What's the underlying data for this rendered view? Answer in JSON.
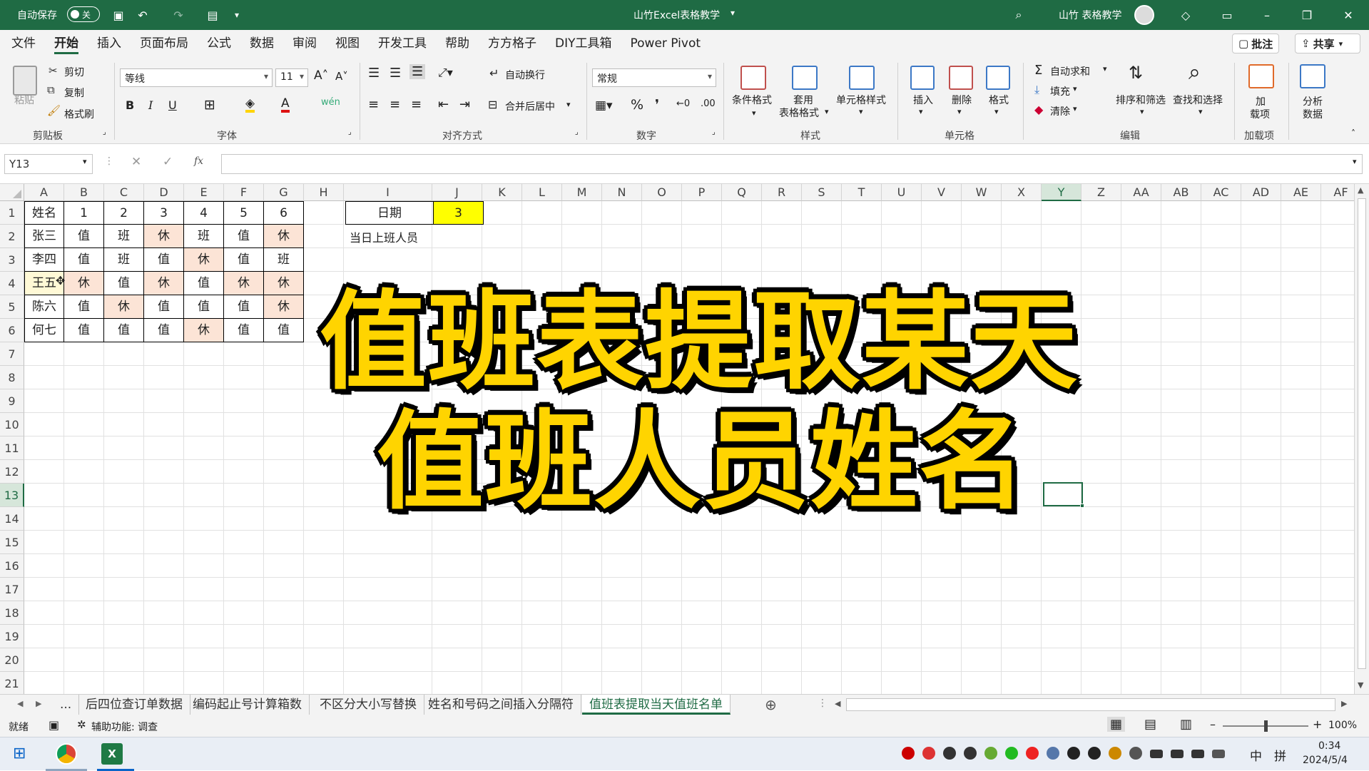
{
  "titlebar": {
    "autosave_label": "自动保存",
    "autosave_state": "关",
    "doc_title": "山竹Excel表格教学",
    "user_name": "山竹 表格教学"
  },
  "menu": {
    "tabs": [
      "文件",
      "开始",
      "插入",
      "页面布局",
      "公式",
      "数据",
      "审阅",
      "视图",
      "开发工具",
      "帮助",
      "方方格子",
      "DIY工具箱",
      "Power Pivot"
    ],
    "comments_label": "批注",
    "share_label": "共享"
  },
  "ribbon": {
    "clipboard": {
      "paste": "粘贴",
      "cut": "剪切",
      "copy": "复制",
      "format_painter": "格式刷",
      "group": "剪贴板"
    },
    "font": {
      "name": "等线",
      "size": "11",
      "group": "字体",
      "bold": "B",
      "italic": "I",
      "underline": "U"
    },
    "align": {
      "wrap": "自动换行",
      "merge": "合并后居中",
      "group": "对齐方式"
    },
    "number": {
      "format": "常规",
      "group": "数字"
    },
    "styles": {
      "cond": "条件格式",
      "table1": "套用",
      "table2": "表格格式",
      "cell": "单元格样式",
      "group": "样式"
    },
    "cells": {
      "insert": "插入",
      "delete": "删除",
      "format": "格式",
      "group": "单元格"
    },
    "editing": {
      "autosum": "自动求和",
      "fill": "填充",
      "clear": "清除",
      "sort": "排序和筛选",
      "find": "查找和选择",
      "group": "编辑"
    },
    "addins": {
      "addin1": "加",
      "addin2": "载项",
      "group": "加载项"
    },
    "analysis": {
      "a1": "分析",
      "a2": "数据"
    }
  },
  "formula_bar": {
    "name_box": "Y13",
    "fx": "fx",
    "value": ""
  },
  "columns": [
    "A",
    "B",
    "C",
    "D",
    "E",
    "F",
    "G",
    "H",
    "I",
    "J",
    "K",
    "L",
    "M",
    "N",
    "O",
    "P",
    "Q",
    "R",
    "S",
    "T",
    "U",
    "V",
    "W",
    "X",
    "Y",
    "Z",
    "AA",
    "AB",
    "AC",
    "AD",
    "AE",
    "AF"
  ],
  "rows": [
    "1",
    "2",
    "3",
    "4",
    "5",
    "6",
    "7",
    "8",
    "9",
    "10",
    "11",
    "12",
    "13",
    "14",
    "15",
    "16",
    "17",
    "18",
    "19",
    "20",
    "21"
  ],
  "table": {
    "header": [
      "姓名",
      "1",
      "2",
      "3",
      "4",
      "5",
      "6"
    ],
    "rows": [
      [
        "张三",
        "值",
        "班",
        "休",
        "班",
        "值",
        "休"
      ],
      [
        "李四",
        "值",
        "班",
        "值",
        "休",
        "值",
        "班"
      ],
      [
        "王五",
        "休",
        "值",
        "休",
        "值",
        "休",
        "休"
      ],
      [
        "陈六",
        "值",
        "休",
        "值",
        "值",
        "值",
        "休"
      ],
      [
        "何七",
        "值",
        "值",
        "值",
        "休",
        "值",
        "值"
      ]
    ]
  },
  "lookup": {
    "date_label": "日期",
    "date_value": "3",
    "staff_label": "当日上班人员"
  },
  "overlay": {
    "line1": "值班表提取某天",
    "line2": "值班人员姓名"
  },
  "sheet_tabs": [
    "...",
    "后四位查订单数据",
    "编码起止号计算箱数",
    "不区分大小写替换",
    "姓名和号码之间插入分隔符",
    "值班表提取当天值班名单"
  ],
  "status": {
    "ready": "就绪",
    "accessibility": "辅助功能: 调查",
    "zoom": "100%"
  },
  "taskbar": {
    "time": "0:34",
    "date": "2024/5/4",
    "ime1": "中",
    "ime2": "拼"
  },
  "colors": {
    "excel_green": "#1f6b44",
    "highlight_yellow": "#ffff00",
    "rest_pink": "#fce4d6",
    "overlay_yellow": "#ffd400"
  }
}
